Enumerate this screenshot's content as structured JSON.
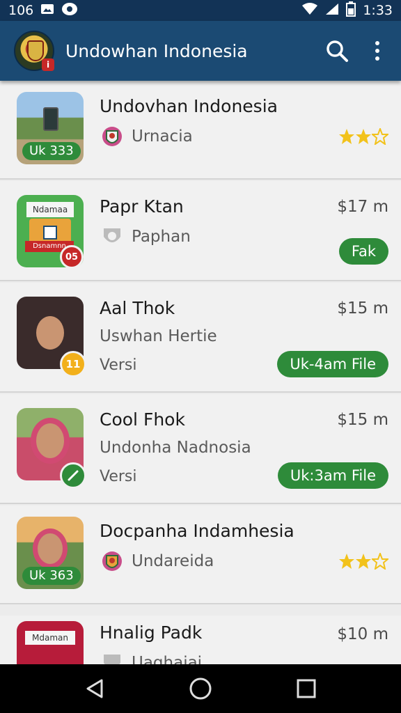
{
  "status_bar": {
    "left_text": "106",
    "time": "1:33"
  },
  "app_bar": {
    "title": "Undowhan Indonesia",
    "logo_badge": "i",
    "icons": [
      "search-icon",
      "more-vert-icon"
    ]
  },
  "rows": [
    {
      "title": "Undovhan Indonesia",
      "subtitle": "Urnacia",
      "thumb_tag": "Uk 333",
      "rating_icons": [
        "flower-star-filled",
        "flower-star-filled",
        "star-outline"
      ]
    },
    {
      "title": "Papr Ktan",
      "subtitle": "Paphan",
      "price": "$17 m",
      "pill": "Fak",
      "thumb_sign_top": "Ndamaa",
      "thumb_sign_bottom": "Dsnamnn",
      "thumb_badge": "05"
    },
    {
      "title": "Aal Thok",
      "subtitle": "Uswhan Hertie",
      "versi": "Versi",
      "price": "$15 m",
      "pill": "Uk-4am File",
      "thumb_badge": "11"
    },
    {
      "title": "Cool Fhok",
      "subtitle": "Undonha Nadnosia",
      "versi": "Versi",
      "price": "$15 m",
      "pill": "Uk:3am File",
      "thumb_badge_icon": "edit-icon"
    },
    {
      "title": "Docpanha Indamhesia",
      "subtitle": "Undareida",
      "thumb_tag": "Uk 363",
      "rating_icons": [
        "flower-star-filled",
        "flower-star-filled",
        "star-outline"
      ]
    },
    {
      "title": "Hnalig Padk",
      "subtitle": "Uaghaiai",
      "price": "$10 m",
      "thumb_sign_top": "Mdaman"
    }
  ],
  "colors": {
    "app_bar": "#1b4a73",
    "status_bar": "#123356",
    "accent_green": "#2e8b3a",
    "star_yellow": "#f2c21b"
  }
}
